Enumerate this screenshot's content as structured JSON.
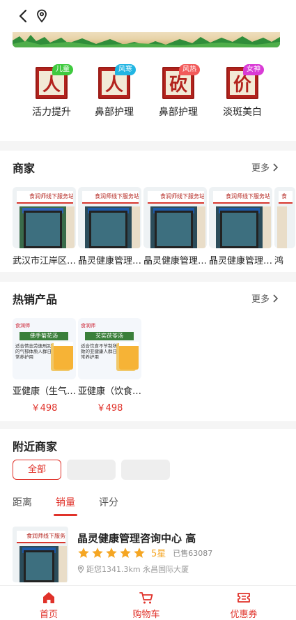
{
  "colors": {
    "accent": "#e0322a",
    "tile": "#b3231d",
    "star": "#f5a623"
  },
  "topbar": {
    "back_icon": "chevron-left-icon",
    "location_icon": "location-pin-icon"
  },
  "categories": [
    {
      "glyph": "人",
      "tag": "儿童",
      "tag_color": "#3fca3f",
      "label": "活力提升"
    },
    {
      "glyph": "人",
      "tag": "风寒",
      "tag_color": "#21b5e3",
      "label": "鼻部护理"
    },
    {
      "glyph": "砍",
      "tag": "风热",
      "tag_color": "#f25a5a",
      "label": "鼻部护理"
    },
    {
      "glyph": "价",
      "tag": "女神",
      "tag_color": "#d93bd6",
      "label": "淡斑美白"
    }
  ],
  "merchants": {
    "title": "商家",
    "more": "更多",
    "items": [
      {
        "sign": "食润师线下服务站",
        "name": "武汉市江岸区…"
      },
      {
        "sign": "食润师线下服务站",
        "name": "晶灵健康管理…"
      },
      {
        "sign": "食润师线下服务站",
        "name": "晶灵健康管理…"
      },
      {
        "sign": "食润师线下服务站",
        "name": "晶灵健康管理…"
      },
      {
        "sign": "食",
        "name": "鸿"
      }
    ]
  },
  "hot": {
    "title": "热销产品",
    "more": "更多",
    "items": [
      {
        "logo": "食润师",
        "ptitle": "佛手菊花汤",
        "desc": "适合情志劳逸刑别的气郁体质人群日常养护用",
        "name": "亚健康（生气…",
        "price": "￥498"
      },
      {
        "logo": "食润师",
        "ptitle": "芡实茯苓汤",
        "desc": "适合饮食不节制所致的亚健康人群日常养护用",
        "name": "亚健康（饮食…",
        "price": "￥498"
      }
    ]
  },
  "nearby": {
    "title": "附近商家",
    "chip_all": "全部",
    "sorts": [
      "距离",
      "销量",
      "评分"
    ],
    "shop": {
      "name": "晶灵健康管理咨询中心 高",
      "rating": "5星",
      "sold": "已售63087",
      "distance": "距您1341.3km 永昌国际大厦"
    }
  },
  "tabbar": [
    {
      "label": "首页",
      "icon": "home-icon"
    },
    {
      "label": "购物车",
      "icon": "cart-icon"
    },
    {
      "label": "优惠券",
      "icon": "coupon-icon"
    }
  ]
}
